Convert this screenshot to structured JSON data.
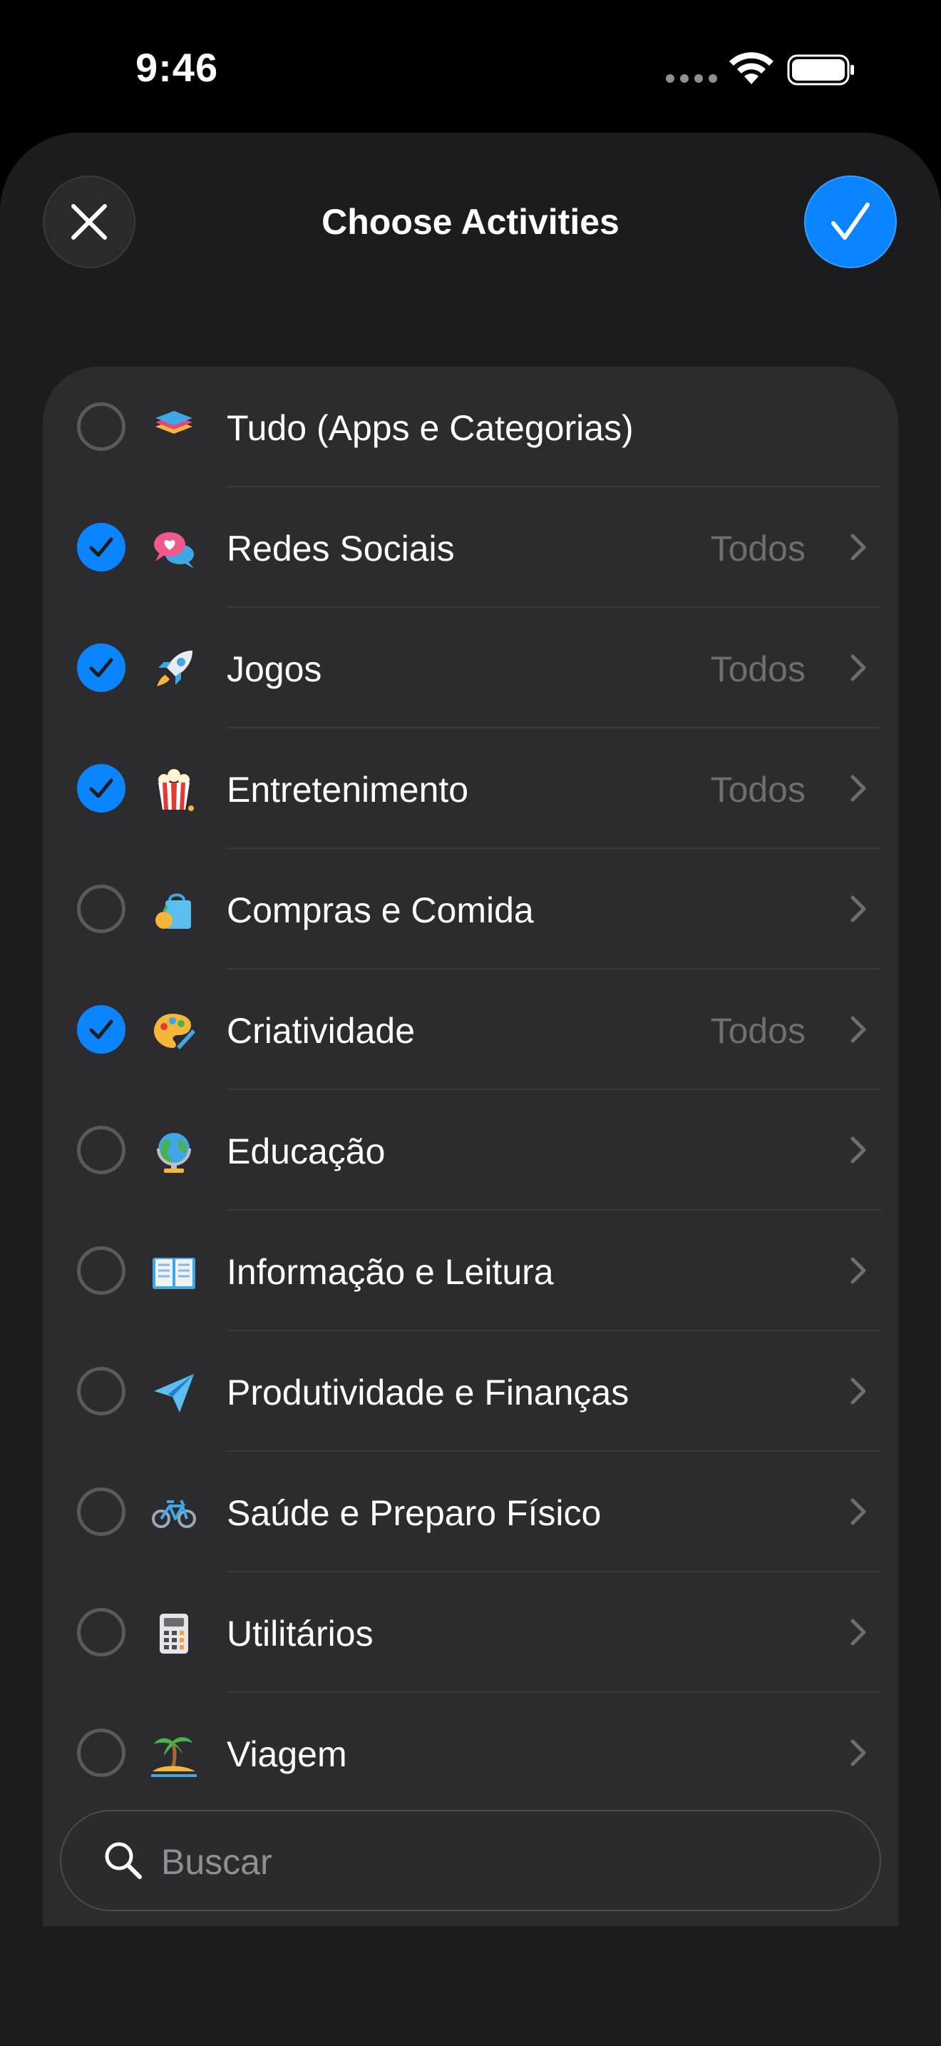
{
  "status_bar": {
    "time": "9:46"
  },
  "header": {
    "title": "Choose Activities"
  },
  "activities": [
    {
      "label": "Tudo (Apps e Categorias)",
      "icon": "stack-icon",
      "checked": false,
      "value": "",
      "chevron": false
    },
    {
      "label": "Redes Sociais",
      "icon": "speech-bubbles-heart-icon",
      "checked": true,
      "value": "Todos",
      "chevron": true
    },
    {
      "label": "Jogos",
      "icon": "rocket-icon",
      "checked": true,
      "value": "Todos",
      "chevron": true
    },
    {
      "label": "Entretenimento",
      "icon": "popcorn-icon",
      "checked": true,
      "value": "Todos",
      "chevron": true
    },
    {
      "label": "Compras e Comida",
      "icon": "shopping-bag-icon",
      "checked": false,
      "value": "",
      "chevron": true
    },
    {
      "label": "Criatividade",
      "icon": "palette-icon",
      "checked": true,
      "value": "Todos",
      "chevron": true
    },
    {
      "label": "Educação",
      "icon": "globe-icon",
      "checked": false,
      "value": "",
      "chevron": true
    },
    {
      "label": "Informação e Leitura",
      "icon": "open-book-icon",
      "checked": false,
      "value": "",
      "chevron": true
    },
    {
      "label": "Produtividade e Finanças",
      "icon": "paper-plane-icon",
      "checked": false,
      "value": "",
      "chevron": true
    },
    {
      "label": "Saúde e Preparo Físico",
      "icon": "bicycle-icon",
      "checked": false,
      "value": "",
      "chevron": true
    },
    {
      "label": "Utilitários",
      "icon": "calculator-icon",
      "checked": false,
      "value": "",
      "chevron": true
    },
    {
      "label": "Viagem",
      "icon": "palm-island-icon",
      "checked": false,
      "value": "",
      "chevron": true
    }
  ],
  "search": {
    "placeholder": "Buscar"
  },
  "colors": {
    "accent": "#0a84ff",
    "sheet": "#1c1c1e",
    "card": "#2c2c2e",
    "secondary_text": "#6d6d72"
  }
}
